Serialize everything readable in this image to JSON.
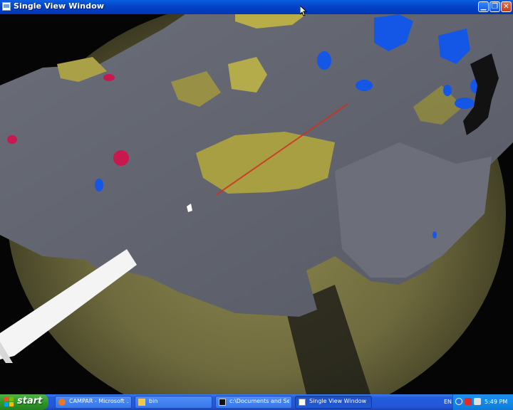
{
  "window": {
    "title": "Single View Window",
    "icon": "app-window-icon",
    "buttons": {
      "minimize": "minimize-icon",
      "maximize": "restore-icon",
      "close": "close-icon"
    }
  },
  "scene": {
    "description_icon": "3d-endoscopy-view",
    "colors": {
      "background": "#050505",
      "endoscope_disk": "#6e6a3e",
      "mesh": "#61646e",
      "yellow_patch": "#b0a444",
      "blue_marker": "#1050e0",
      "red_marker": "#c8184e",
      "laser": "#d03020",
      "instrument": "#f4f4f4"
    }
  },
  "taskbar": {
    "start_label": "start",
    "tasks": [
      {
        "label": "CAMPAR - Microsoft ...",
        "icon": "firefox-icon",
        "active": false
      },
      {
        "label": "bin",
        "icon": "folder-icon",
        "active": false
      },
      {
        "label": "c:\\Documents and Se...",
        "icon": "console-icon",
        "active": false
      },
      {
        "label": "Single View Window",
        "icon": "window-icon",
        "active": true
      }
    ],
    "tray": {
      "language": "EN",
      "icons": [
        "bluetooth-icon",
        "network-icon",
        "volume-icon"
      ],
      "clock": "5:49 PM"
    }
  }
}
